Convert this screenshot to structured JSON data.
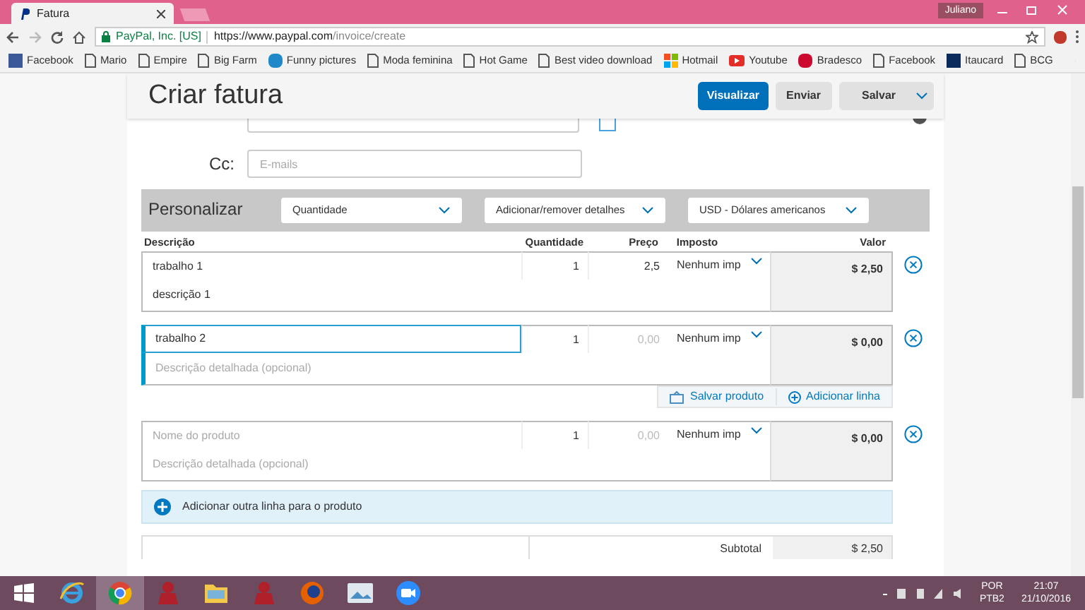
{
  "browser": {
    "tab_title": "Fatura",
    "user": "Juliano",
    "site": "PayPal, Inc. [US]",
    "url_host": "https://www.paypal.com",
    "url_path": "/invoice/create",
    "bookmarks": [
      {
        "label": "Facebook",
        "kind": "fb"
      },
      {
        "label": "Mario",
        "kind": "page"
      },
      {
        "label": "Empire",
        "kind": "page"
      },
      {
        "label": "Big Farm",
        "kind": "page"
      },
      {
        "label": "Funny pictures",
        "kind": "smile"
      },
      {
        "label": "Moda feminina",
        "kind": "page"
      },
      {
        "label": "Hot Game",
        "kind": "page"
      },
      {
        "label": "Best video download",
        "kind": "page"
      },
      {
        "label": "Hotmail",
        "kind": "ms"
      },
      {
        "label": "Youtube",
        "kind": "yt"
      },
      {
        "label": "Bradesco",
        "kind": "bank"
      },
      {
        "label": "Facebook",
        "kind": "page"
      },
      {
        "label": "Itaucard",
        "kind": "itau"
      },
      {
        "label": "BCG",
        "kind": "page"
      }
    ]
  },
  "page": {
    "title": "Criar fatura",
    "buttons": [
      {
        "label": "Visualizar",
        "kind": "primary"
      },
      {
        "label": "Enviar",
        "kind": "secondary"
      },
      {
        "label": "Salvar",
        "kind": "menu"
      }
    ],
    "cc": {
      "label": "Cc:",
      "placeholder": "E-mails"
    },
    "customize": {
      "label": "Personalizar",
      "dropdowns": [
        "Quantidade",
        "Adicionar/remover detalhes",
        "USD - Dólares americanos"
      ]
    },
    "columns": [
      "Descrição",
      "Quantidade",
      "Preço",
      "Imposto",
      "Valor"
    ],
    "items": [
      {
        "focused": false,
        "name": "trabalho 1",
        "details": "descrição 1",
        "quantity": "1",
        "price": "2,5",
        "tax": "Nenhum imp",
        "amount": "$ 2,50"
      },
      {
        "focused": true,
        "name": "trabalho 2",
        "details_placeholder": "Descrição detalhada (opcional)",
        "quantity": "1",
        "price_placeholder": "0,00",
        "tax": "Nenhum imp",
        "amount": "$ 0,00",
        "actions": [
          "Salvar produto",
          "Adicionar linha"
        ]
      },
      {
        "focused": false,
        "name_placeholder": "Nome do produto",
        "details_placeholder": "Descrição detalhada (opcional)",
        "quantity": "1",
        "price_placeholder": "0,00",
        "tax": "Nenhum imp",
        "amount": "$ 0,00"
      }
    ],
    "add_line": "Adicionar outra linha para o produto",
    "subtotal": {
      "label": "Subtotal",
      "value": "$ 2,50"
    }
  },
  "taskbar": {
    "lang": "POR",
    "layout": "PTB2",
    "time": "21:07",
    "date": "21/10/2016"
  }
}
